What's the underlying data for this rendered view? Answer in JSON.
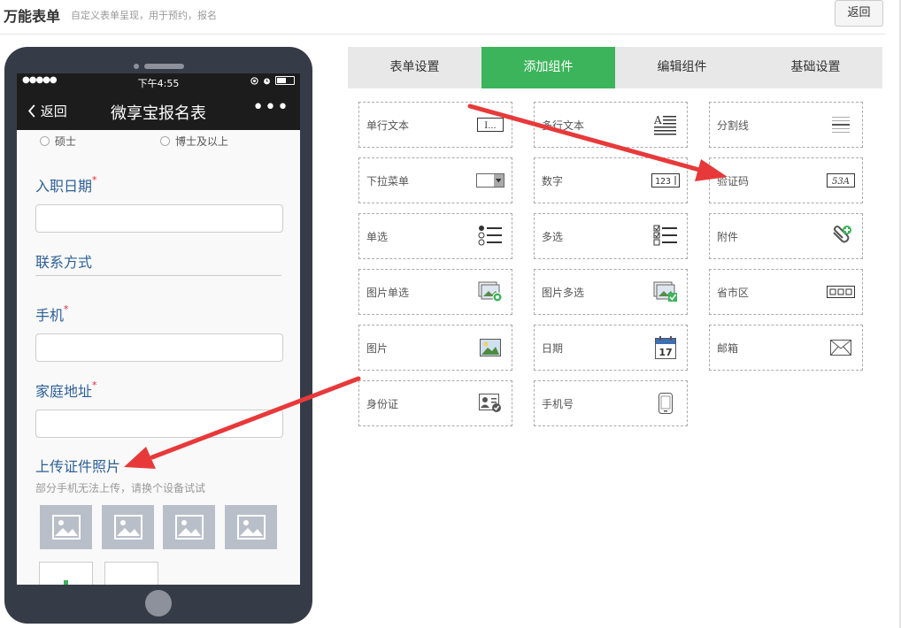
{
  "header": {
    "title": "万能表单",
    "subtitle": "自定义表单呈现，用于预约，报名",
    "back_label": "返回"
  },
  "phone": {
    "status": {
      "signal": "●●●●●",
      "time": "下午4:55"
    },
    "nav": {
      "back_label": "返回",
      "title": "微享宝报名表",
      "more": "•••"
    },
    "radio_options": [
      "硕士",
      "博士及以上"
    ],
    "fields": {
      "hire_date": "入职日期",
      "contact_section": "联系方式",
      "mobile": "手机",
      "home_address": "家庭地址",
      "upload_photo": "上传证件照片",
      "upload_hint": "部分手机无法上传，请换个设备试试",
      "required_mark": "*"
    }
  },
  "tabs": [
    {
      "label": "表单设置",
      "active": false
    },
    {
      "label": "添加组件",
      "active": true
    },
    {
      "label": "编辑组件",
      "active": false
    },
    {
      "label": "基础设置",
      "active": false
    }
  ],
  "components": [
    {
      "label": "单行文本",
      "icon": "single-line-text-icon",
      "glyph": "I..."
    },
    {
      "label": "多行文本",
      "icon": "multi-line-text-icon",
      "glyph": ""
    },
    {
      "label": "分割线",
      "icon": "divider-line-icon",
      "glyph": ""
    },
    {
      "label": "下拉菜单",
      "icon": "dropdown-icon",
      "glyph": ""
    },
    {
      "label": "数字",
      "icon": "number-icon",
      "glyph": "123"
    },
    {
      "label": "验证码",
      "icon": "captcha-icon",
      "glyph": "53A"
    },
    {
      "label": "单选",
      "icon": "radio-list-icon",
      "glyph": ""
    },
    {
      "label": "多选",
      "icon": "checkbox-list-icon",
      "glyph": ""
    },
    {
      "label": "附件",
      "icon": "paperclip-icon",
      "glyph": ""
    },
    {
      "label": "图片单选",
      "icon": "image-radio-icon",
      "glyph": ""
    },
    {
      "label": "图片多选",
      "icon": "image-checkbox-icon",
      "glyph": ""
    },
    {
      "label": "省市区",
      "icon": "region-select-icon",
      "glyph": ""
    },
    {
      "label": "图片",
      "icon": "image-icon",
      "glyph": ""
    },
    {
      "label": "日期",
      "icon": "calendar-icon",
      "glyph": "17"
    },
    {
      "label": "邮箱",
      "icon": "envelope-icon",
      "glyph": ""
    },
    {
      "label": "身份证",
      "icon": "id-card-icon",
      "glyph": ""
    },
    {
      "label": "手机号",
      "icon": "mobile-phone-icon",
      "glyph": ""
    }
  ],
  "colors": {
    "accent_green": "#3cb45b",
    "label_blue": "#2c5f97",
    "arrow_red": "#e8393a",
    "phone_body": "#363c47"
  }
}
